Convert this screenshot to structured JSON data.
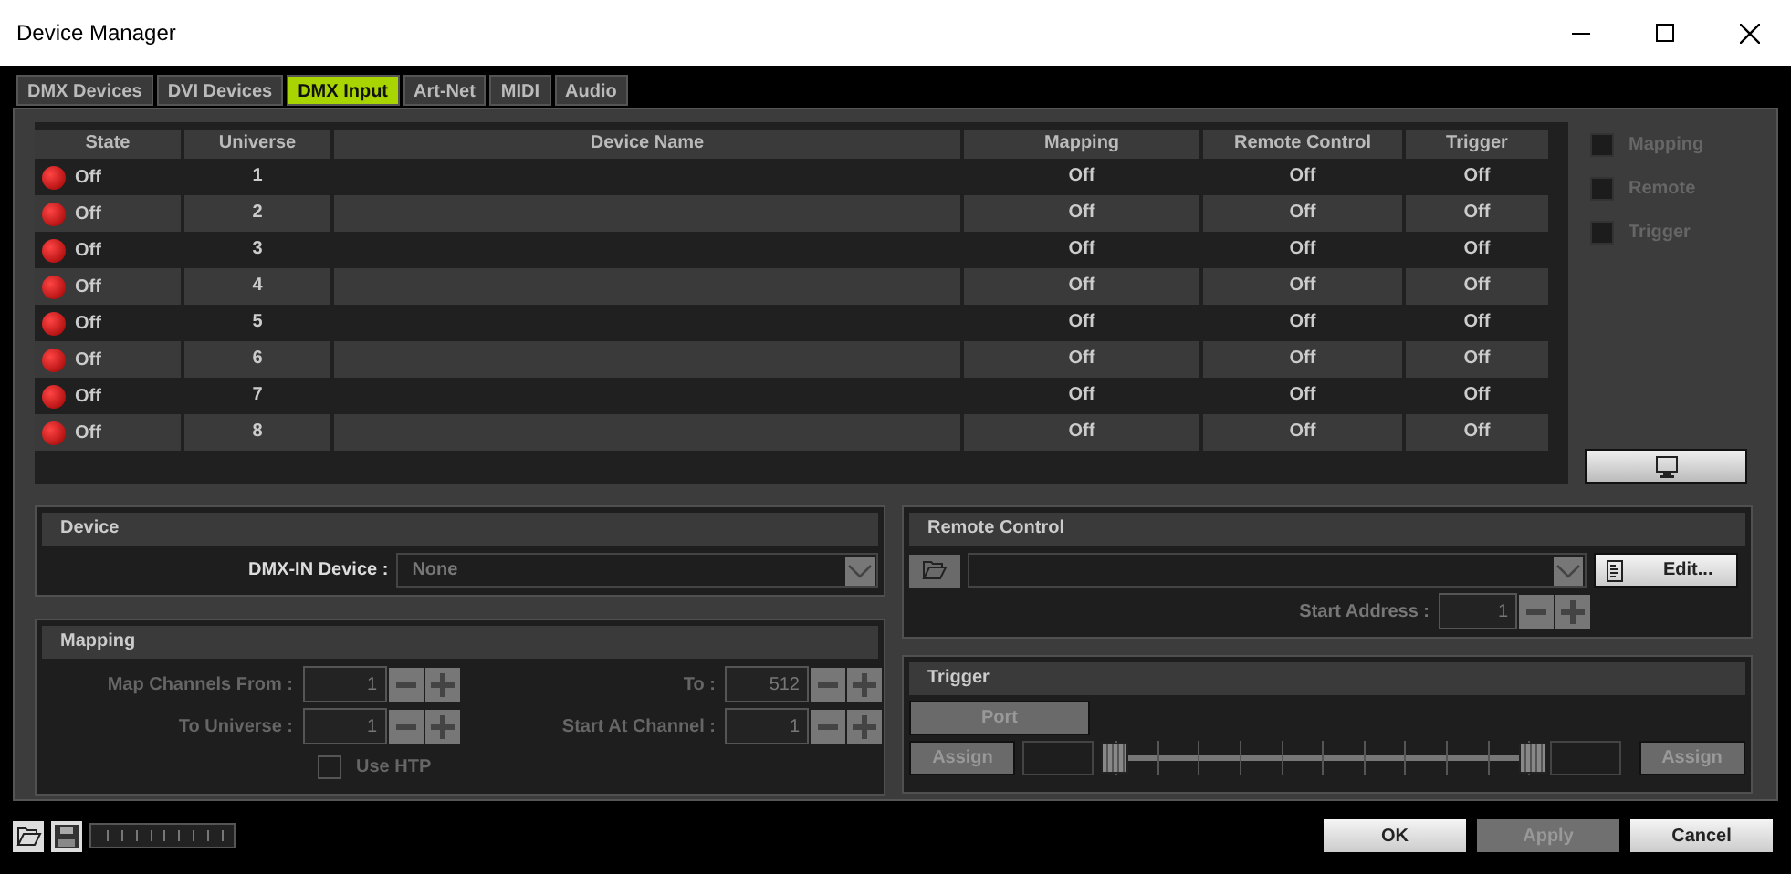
{
  "window": {
    "title": "Device Manager"
  },
  "tabs": [
    {
      "label": "DMX Devices",
      "selected": false
    },
    {
      "label": "DVI Devices",
      "selected": false
    },
    {
      "label": "DMX Input",
      "selected": true
    },
    {
      "label": "Art-Net",
      "selected": false
    },
    {
      "label": "MIDI",
      "selected": false
    },
    {
      "label": "Audio",
      "selected": false
    }
  ],
  "table": {
    "columns": [
      "State",
      "Universe",
      "Device Name",
      "Mapping",
      "Remote Control",
      "Trigger"
    ],
    "rows": [
      {
        "state": "Off",
        "on": false,
        "universe": "1",
        "mapping": "Off",
        "remote_control": "Off",
        "trigger": "Off"
      },
      {
        "state": "Off",
        "on": false,
        "universe": "2",
        "mapping": "Off",
        "remote_control": "Off",
        "trigger": "Off"
      },
      {
        "state": "Off",
        "on": false,
        "universe": "3",
        "mapping": "Off",
        "remote_control": "Off",
        "trigger": "Off"
      },
      {
        "state": "Off",
        "on": false,
        "universe": "4",
        "mapping": "Off",
        "remote_control": "Off",
        "trigger": "Off"
      },
      {
        "state": "Off",
        "on": false,
        "universe": "5",
        "mapping": "Off",
        "remote_control": "Off",
        "trigger": "Off"
      },
      {
        "state": "Off",
        "on": false,
        "universe": "6",
        "mapping": "Off",
        "remote_control": "Off",
        "trigger": "Off"
      },
      {
        "state": "Off",
        "on": false,
        "universe": "7",
        "mapping": "Off",
        "remote_control": "Off",
        "trigger": "Off"
      },
      {
        "state": "Off",
        "on": false,
        "universe": "8",
        "mapping": "Off",
        "remote_control": "Off",
        "trigger": "Off"
      }
    ]
  },
  "filters": [
    {
      "label": "Mapping",
      "checked": false
    },
    {
      "label": "Remote",
      "checked": false
    },
    {
      "label": "Trigger",
      "checked": false
    }
  ],
  "device": {
    "title": "Device",
    "label": "DMX-IN Device :",
    "value": "None"
  },
  "mapping": {
    "title": "Mapping",
    "fields": [
      {
        "label": "Map Channels From :",
        "value": "1"
      },
      {
        "label": "To :",
        "value": "512"
      },
      {
        "label": "To Universe :",
        "value": "1"
      },
      {
        "label": "Start At Channel :",
        "value": "1"
      }
    ],
    "use_htp": {
      "label": "Use HTP",
      "checked": false
    }
  },
  "remote_control": {
    "title": "Remote Control",
    "edit_button": "Edit...",
    "start_address": {
      "label": "Start Address :",
      "value": "1"
    }
  },
  "trigger": {
    "title": "Trigger",
    "port_button": "Port",
    "assign_left": "Assign",
    "assign_right": "Assign",
    "thumbs": [
      {
        "level": 0
      },
      {
        "level": 1
      }
    ]
  },
  "buttons": [
    {
      "label": "OK",
      "disabled": false
    },
    {
      "label": "Apply",
      "disabled": true
    },
    {
      "label": "Cancel",
      "disabled": false
    }
  ]
}
